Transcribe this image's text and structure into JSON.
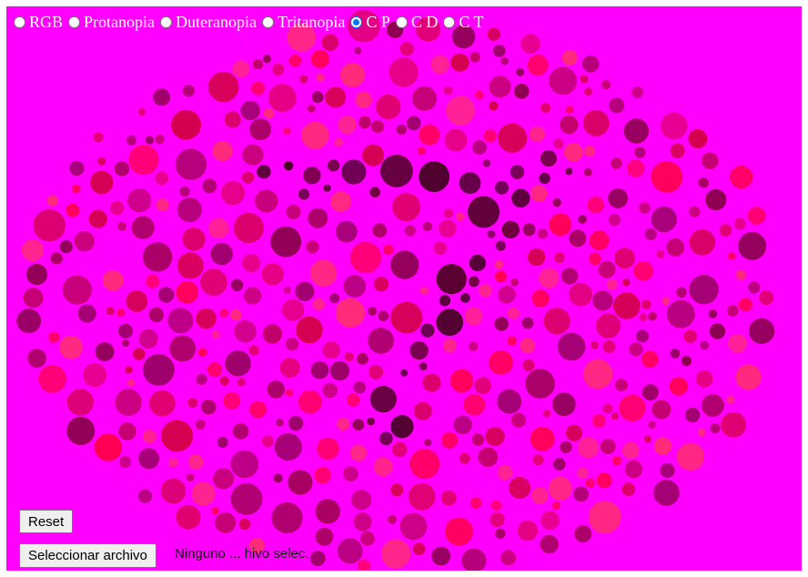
{
  "modes": {
    "options": [
      {
        "label": "RGB",
        "checked": false
      },
      {
        "label": "Protanopia",
        "checked": false
      },
      {
        "label": "Duteranopia",
        "checked": false
      },
      {
        "label": "Tritanopia",
        "checked": false
      },
      {
        "label": "C P",
        "checked": true
      },
      {
        "label": "C D",
        "checked": false
      },
      {
        "label": "C T",
        "checked": false
      }
    ]
  },
  "image": {
    "background_color": "#ff00ff",
    "dot_colors": [
      "#ff0055",
      "#e00070",
      "#c2006c",
      "#a80062",
      "#ff2a7a",
      "#d4004f",
      "#8e0052"
    ],
    "figure_colors": [
      "#5a0032",
      "#4a0028",
      "#6e003e"
    ]
  },
  "controls": {
    "reset_label": "Reset",
    "file_button_label": "Seleccionar archivo",
    "file_status": "Ninguno ... hivo selec."
  }
}
